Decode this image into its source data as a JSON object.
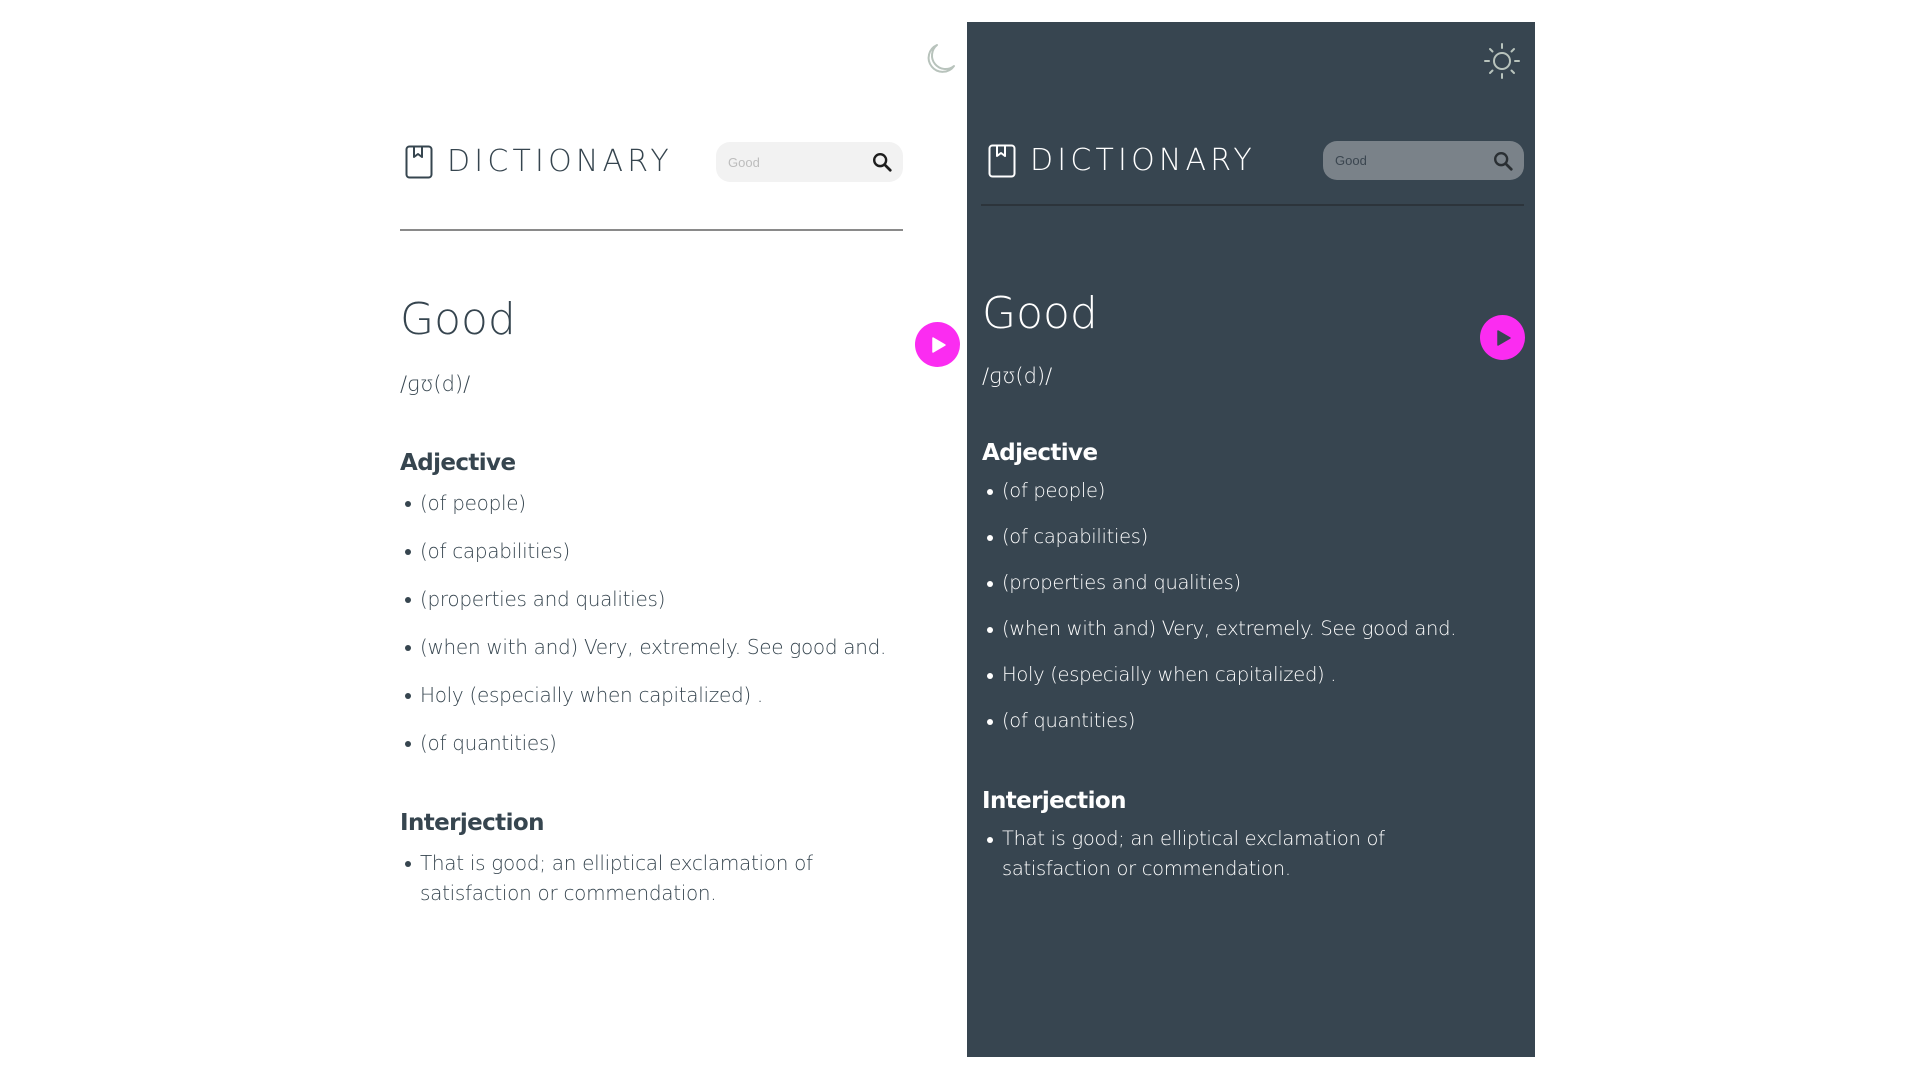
{
  "colors": {
    "light_bg": "#ffffff",
    "light_text": "#36454f",
    "dark_bg": "#374550",
    "dark_text": "#ffffff",
    "accent": "#fb2cf1"
  },
  "light": {
    "theme_toggle_icon": "moon-icon",
    "app_title": "DICTIONARY",
    "logo_icon": "book-bookmark-icon",
    "search": {
      "placeholder": "Good",
      "value": "",
      "icon": "search-icon"
    },
    "word": "Good",
    "phonetic": "/ɡʊ(d)/",
    "play_icon": "play-icon",
    "meanings": [
      {
        "part_of_speech": "Adjective",
        "definitions": [
          "(of people)",
          "(of capabilities)",
          "(properties and qualities)",
          "(when with and) Very, extremely. See good and.",
          "Holy (especially when capitalized) .",
          "(of quantities)"
        ]
      },
      {
        "part_of_speech": "Interjection",
        "definitions": [
          "That is good; an elliptical exclamation of satisfaction or commendation."
        ]
      }
    ]
  },
  "dark": {
    "theme_toggle_icon": "sun-icon",
    "app_title": "DICTIONARY",
    "logo_icon": "book-bookmark-icon",
    "search": {
      "placeholder": "Good",
      "value": "",
      "icon": "search-icon"
    },
    "word": "Good",
    "phonetic": "/ɡʊ(d)/",
    "play_icon": "play-icon",
    "meanings": [
      {
        "part_of_speech": "Adjective",
        "definitions": [
          "(of people)",
          "(of capabilities)",
          "(properties and qualities)",
          "(when with and) Very, extremely. See good and.",
          "Holy (especially when capitalized) .",
          "(of quantities)"
        ]
      },
      {
        "part_of_speech": "Interjection",
        "definitions": [
          "That is good; an elliptical exclamation of satisfaction or commendation."
        ]
      }
    ]
  }
}
